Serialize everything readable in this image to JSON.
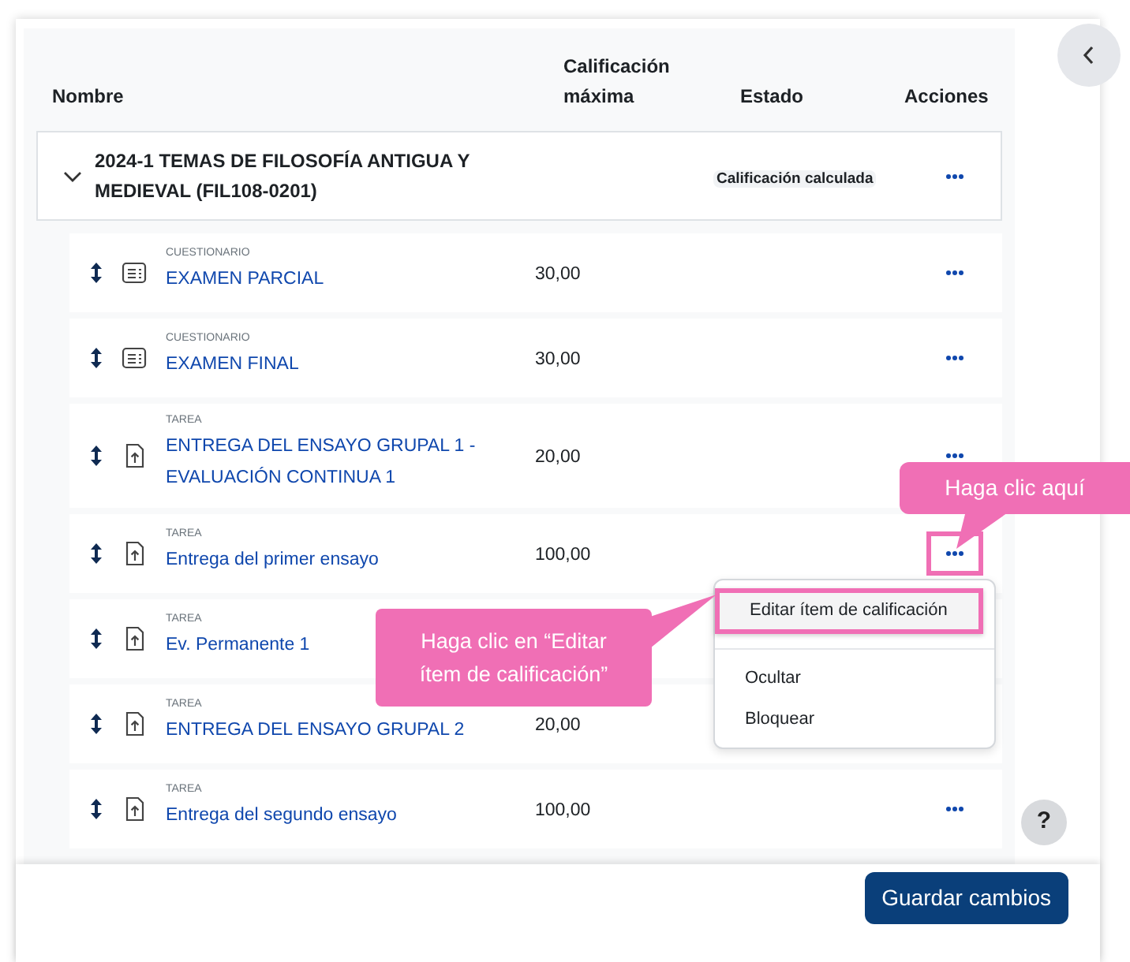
{
  "columns": [
    "Nombre",
    "Calificación máxima",
    "Estado",
    "Acciones"
  ],
  "category": {
    "title": "2024-1 TEMAS DE FILOSOFÍA ANTIGUA Y MEDIEVAL (FIL108-0201)",
    "expanded": true,
    "status": "Calificación calculada"
  },
  "items": [
    {
      "kind": "quiz",
      "type_label": "CUESTIONARIO",
      "name": "EXAMEN PARCIAL",
      "max_grade": "30,00"
    },
    {
      "kind": "quiz",
      "type_label": "CUESTIONARIO",
      "name": "EXAMEN FINAL",
      "max_grade": "30,00"
    },
    {
      "kind": "assignment",
      "type_label": "TAREA",
      "name": "ENTREGA DEL ENSAYO GRUPAL 1 - EVALUACIÓN CONTINUA 1",
      "max_grade": "20,00"
    },
    {
      "kind": "assignment",
      "type_label": "TAREA",
      "name": "Entrega del primer ensayo",
      "max_grade": "100,00",
      "menu": [
        {
          "label": "Editar ítem de calificación",
          "highlighted": true
        },
        {
          "label": "Ocultar",
          "highlighted": false
        },
        {
          "label": "Bloquear",
          "highlighted": false
        }
      ]
    },
    {
      "kind": "assignment",
      "type_label": "TAREA",
      "name": "Ev. Permanente 1"
    },
    {
      "kind": "assignment",
      "type_label": "TAREA",
      "name": "ENTREGA DEL ENSAYO GRUPAL 2",
      "max_grade": "20,00"
    },
    {
      "kind": "assignment",
      "type_label": "TAREA",
      "name": "Entrega del segundo ensayo",
      "max_grade": "100,00"
    }
  ],
  "callouts": [
    {
      "text": "Haga clic aquí"
    },
    {
      "text": "Haga clic en “Editar ítem de calificación”"
    }
  ],
  "help_button": "?",
  "save_button": "Guardar cambios"
}
